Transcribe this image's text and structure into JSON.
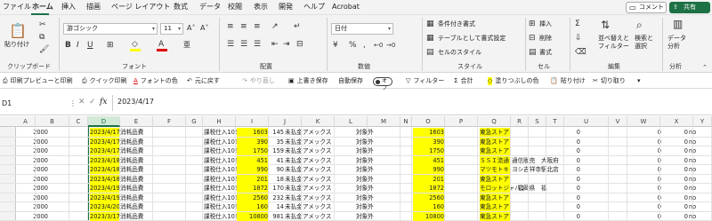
{
  "menu": {
    "tabs": [
      "ファイル",
      "ホーム",
      "挿入",
      "描画",
      "ページ レイアウト",
      "数式",
      "データ",
      "校閲",
      "表示",
      "開発",
      "ヘルプ",
      "Acrobat"
    ],
    "active_tab": "ホーム",
    "comment_label": "コメント",
    "share_label": "共有"
  },
  "ribbon": {
    "clipboard": {
      "paste_label": "貼り付け",
      "group_label": "クリップボード"
    },
    "font": {
      "font_name": "游ゴシック",
      "font_size": "11",
      "group_label": "フォント"
    },
    "alignment": {
      "group_label": "配置"
    },
    "number": {
      "format": "日付",
      "group_label": "数値"
    },
    "styles": {
      "conditional": "条件付き書式",
      "table": "テーブルとして書式設定",
      "cell_styles": "セルのスタイル",
      "group_label": "スタイル"
    },
    "cells": {
      "insert": "挿入",
      "delete": "削除",
      "format": "書式",
      "group_label": "セル"
    },
    "editing": {
      "sort_filter": "並べ替えと\nフィルター",
      "find": "検索と\n選択",
      "group_label": "編集"
    },
    "analysis": {
      "analyze": "データ\n分析",
      "group_label": "分析"
    }
  },
  "quick_access": {
    "items": [
      "印刷プレビューと印刷",
      "クイック印刷",
      "フォントの色",
      "元に戻す",
      "やり直し",
      "上書き保存",
      "自動保存",
      "フィルター",
      "合計",
      "塗りつぶしの色",
      "貼り付け",
      "切り取り"
    ],
    "autosave_state": "オフ"
  },
  "formula_bar": {
    "name_box": "D1",
    "fx": "fx",
    "value": "2023/4/17"
  },
  "grid": {
    "columns": [
      "A",
      "B",
      "C",
      "D",
      "E",
      "F",
      "G",
      "H",
      "I",
      "J",
      "K",
      "L",
      "M",
      "N",
      "O",
      "P",
      "Q",
      "R",
      "S",
      "T",
      "U",
      "V",
      "W",
      "X",
      "Y"
    ],
    "selected_column": "D",
    "rows": [
      {
        "b": "2000",
        "d": "2023/4/17",
        "e": "消耗品費",
        "h": "課税仕入10%",
        "i": "1603",
        "j": "145",
        "k": "未払金",
        "l": "アメックス",
        "n": "対象外",
        "o": "1603",
        "q": "東急ストア",
        "u": "0",
        "w": "0",
        "x": "0",
        "y": "no"
      },
      {
        "b": "2000",
        "d": "2023/4/17",
        "e": "消耗品費",
        "h": "課税仕入10%",
        "i": "390",
        "j": "35",
        "k": "未払金",
        "l": "アメックス",
        "n": "対象外",
        "o": "390",
        "q": "東急ストア",
        "u": "0",
        "w": "0",
        "x": "0",
        "y": "no"
      },
      {
        "b": "2000",
        "d": "2023/4/17",
        "e": "消耗品費",
        "h": "課税仕入10%",
        "i": "1750",
        "j": "159",
        "k": "未払金",
        "l": "アメックス",
        "n": "対象外",
        "o": "1750",
        "q": "東急ストア",
        "u": "0",
        "w": "0",
        "x": "0",
        "y": "no"
      },
      {
        "b": "2000",
        "d": "2023/4/18",
        "e": "消耗品費",
        "h": "課税仕入10%",
        "i": "451",
        "j": "41",
        "k": "未払金",
        "l": "アメックス",
        "n": "対象外",
        "o": "451",
        "q": "ＳＳＩ流通",
        "r": "通信販売　大阪府",
        "u": "0",
        "w": "0",
        "x": "0",
        "y": "no"
      },
      {
        "b": "2000",
        "d": "2023/4/18",
        "e": "消耗品費",
        "h": "課税仕入10%",
        "i": "990",
        "j": "90",
        "k": "未払金",
        "l": "アメックス",
        "n": "対象外",
        "o": "990",
        "q": "マツモトキ",
        "r": "ヨシ吉祥寺駅北店",
        "u": "0",
        "w": "0",
        "x": "0",
        "y": "no"
      },
      {
        "b": "2000",
        "d": "2023/4/18",
        "e": "消耗品費",
        "h": "課税仕入10%",
        "i": "201",
        "j": "18",
        "k": "未払金",
        "l": "アメックス",
        "n": "対象外",
        "o": "201",
        "q": "東急ストア",
        "u": "0",
        "w": "0",
        "x": "0",
        "y": "no"
      },
      {
        "b": "2000",
        "d": "2023/4/19",
        "e": "消耗品費",
        "h": "課税仕入10%",
        "i": "1872",
        "j": "170",
        "k": "未払金",
        "l": "アメックス",
        "n": "対象外",
        "o": "1872",
        "q": "モロットジャパン",
        "r": "　福岡県　福",
        "u": "0",
        "w": "0",
        "x": "0",
        "y": "no"
      },
      {
        "b": "2000",
        "d": "2023/4/19",
        "e": "消耗品費",
        "h": "課税仕入10%",
        "i": "2560",
        "j": "232",
        "k": "未払金",
        "l": "アメックス",
        "n": "対象外",
        "o": "2560",
        "q": "東急ストア",
        "u": "0",
        "w": "0",
        "x": "0",
        "y": "no"
      },
      {
        "b": "2000",
        "d": "2023/4/20",
        "e": "消耗品費",
        "h": "課税仕入10%",
        "i": "160",
        "j": "14",
        "k": "未払金",
        "l": "アメックス",
        "n": "対象外",
        "o": "160",
        "q": "東急ストア",
        "u": "0",
        "w": "0",
        "x": "0",
        "y": "no"
      },
      {
        "b": "2000",
        "d": "2023/3/17",
        "e": "消耗品費",
        "h": "課税仕入10%",
        "i": "10800",
        "j": "981",
        "k": "未払金",
        "l": "アメックス",
        "n": "対象外",
        "o": "10800",
        "q": "東急ストア",
        "u": "0",
        "w": "0",
        "x": "0",
        "y": "no"
      }
    ]
  },
  "colors": {
    "accent": "#1e7145",
    "highlight": "#ffff00",
    "font_color_bar": "#e00000",
    "fill_color_bar": "#ffff00"
  }
}
